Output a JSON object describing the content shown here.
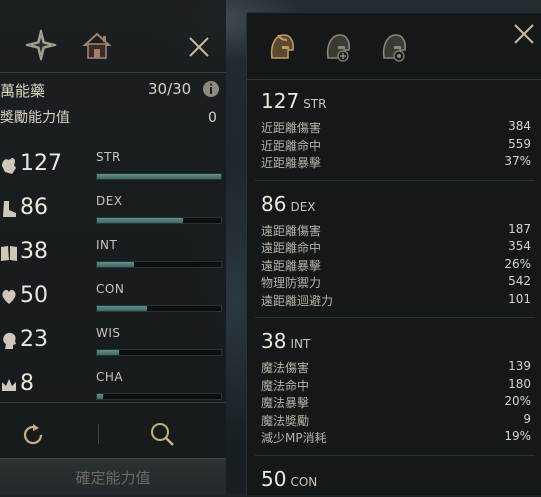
{
  "left_panel": {
    "potion_label": "萬能藥",
    "potion_count": "30/30",
    "bonus_label": "獎勵能力值",
    "bonus_value": "0",
    "stats": [
      {
        "abbr": "STR",
        "value": "127",
        "bar_fraction": 1.0,
        "icon": "fist-icon"
      },
      {
        "abbr": "DEX",
        "value": "86",
        "bar_fraction": 0.69,
        "icon": "boot-icon"
      },
      {
        "abbr": "INT",
        "value": "38",
        "bar_fraction": 0.3,
        "icon": "book-icon"
      },
      {
        "abbr": "CON",
        "value": "50",
        "bar_fraction": 0.4,
        "icon": "heart-icon"
      },
      {
        "abbr": "WIS",
        "value": "23",
        "bar_fraction": 0.18,
        "icon": "head-icon"
      },
      {
        "abbr": "CHA",
        "value": "8",
        "bar_fraction": 0.05,
        "icon": "crown-icon"
      }
    ],
    "confirm_label": "確定能力值"
  },
  "right_panel": {
    "sections": [
      {
        "value": "127",
        "abbr": "STR",
        "rows": [
          {
            "label": "近距離傷害",
            "value": "384"
          },
          {
            "label": "近距離命中",
            "value": "559"
          },
          {
            "label": "近距離暴擊",
            "value": "37%"
          }
        ]
      },
      {
        "value": "86",
        "abbr": "DEX",
        "rows": [
          {
            "label": "遠距離傷害",
            "value": "187"
          },
          {
            "label": "遠距離命中",
            "value": "354"
          },
          {
            "label": "遠距離暴擊",
            "value": "26%"
          },
          {
            "label": "物理防禦力",
            "value": "542"
          },
          {
            "label": "遠距離迴避力",
            "value": "101"
          }
        ]
      },
      {
        "value": "38",
        "abbr": "INT",
        "rows": [
          {
            "label": "魔法傷害",
            "value": "139"
          },
          {
            "label": "魔法命中",
            "value": "180"
          },
          {
            "label": "魔法暴擊",
            "value": "20%"
          },
          {
            "label": "魔法獎勵",
            "value": "9"
          },
          {
            "label": "減少MP消耗",
            "value": "19%"
          }
        ]
      },
      {
        "value": "50",
        "abbr": "CON",
        "rows": []
      }
    ]
  },
  "colors": {
    "bar_fill": "#5e8f8a",
    "helmet_gold": "#c49a5a",
    "helmet_gray": "#8a8676"
  }
}
